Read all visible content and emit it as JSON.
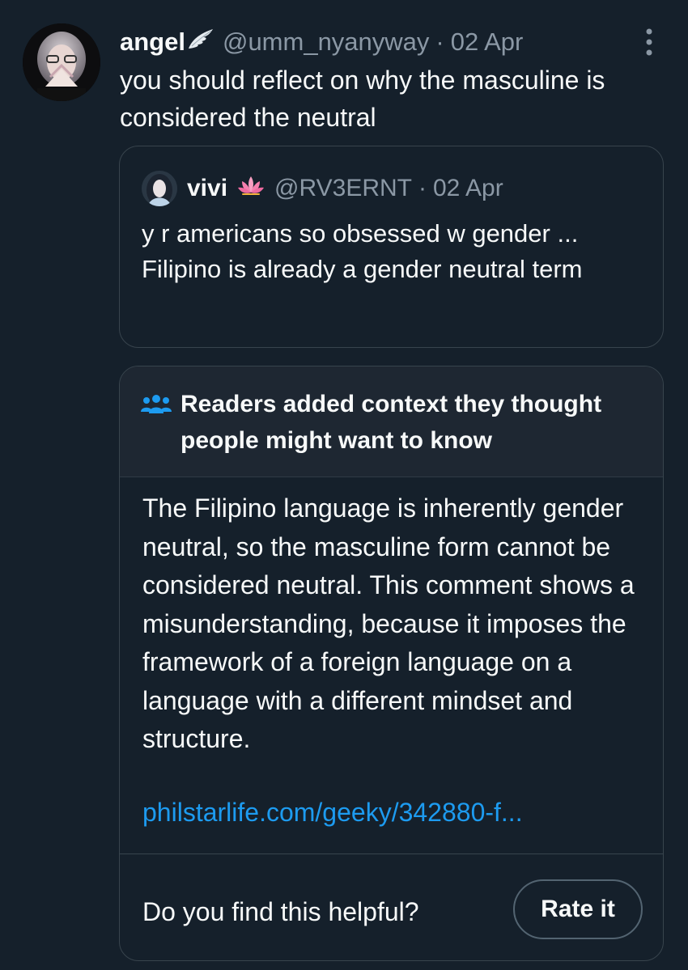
{
  "tweet": {
    "author_name": "angel",
    "author_badge_icon": "wing-icon",
    "handle": "@umm_nyanyway",
    "separator": "·",
    "date": "02 Apr",
    "text": "you should reflect on why the masculine is considered the neutral",
    "more_icon": "more-vertical-icon"
  },
  "quoted_tweet": {
    "author_name": "vivi",
    "author_badge_icon": "lotus-icon",
    "handle": "@RV3ERNT",
    "separator": "·",
    "date": "02 Apr",
    "text": "y r americans so obsessed w gender ... Filipino is already a gender neutral term"
  },
  "community_note": {
    "icon": "people-icon",
    "title": "Readers added context they thought people might want to know",
    "body": "The Filipino language is inherently gender neutral, so the masculine form cannot be considered neutral. This comment shows a misunderstanding, because it imposes the framework of a foreign language on a language with a different mindset and structure.",
    "link_text": "philstarlife.com/geeky/342880-f...",
    "helpful_question": "Do you find this helpful?",
    "rate_button": "Rate it"
  },
  "colors": {
    "background": "#15202b",
    "text_primary": "#f7f9f9",
    "text_secondary": "#8b98a5",
    "border": "#38444d",
    "link": "#1d9bf0",
    "note_header_bg": "#1e2732"
  }
}
